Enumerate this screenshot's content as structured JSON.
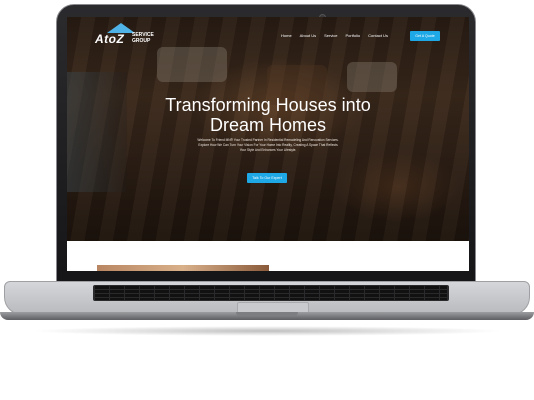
{
  "logo": {
    "brand": "AtoZ",
    "subtitle": "SERVICE GROUP"
  },
  "nav": {
    "items": [
      "Home",
      "About Us",
      "Service",
      "Portfolio",
      "Contact Us"
    ]
  },
  "header": {
    "cta_label": "Get A Quote"
  },
  "hero": {
    "headline_line1": "Transforming Houses into",
    "headline_line2": "Dream Homes",
    "description": "Welcome To Friend MN® Your Trusted Partner In Residential Remodeling And Renovation Services. Explore How We Can Turn Your Vision For Your Home Into Reality, Creating A Space That Reflects Your Style And Enhances Your Lifestyle.",
    "cta_label": "Talk To Our Expert"
  },
  "colors": {
    "accent": "#1ea8e6",
    "logo_roof": "#4fb3e8"
  }
}
